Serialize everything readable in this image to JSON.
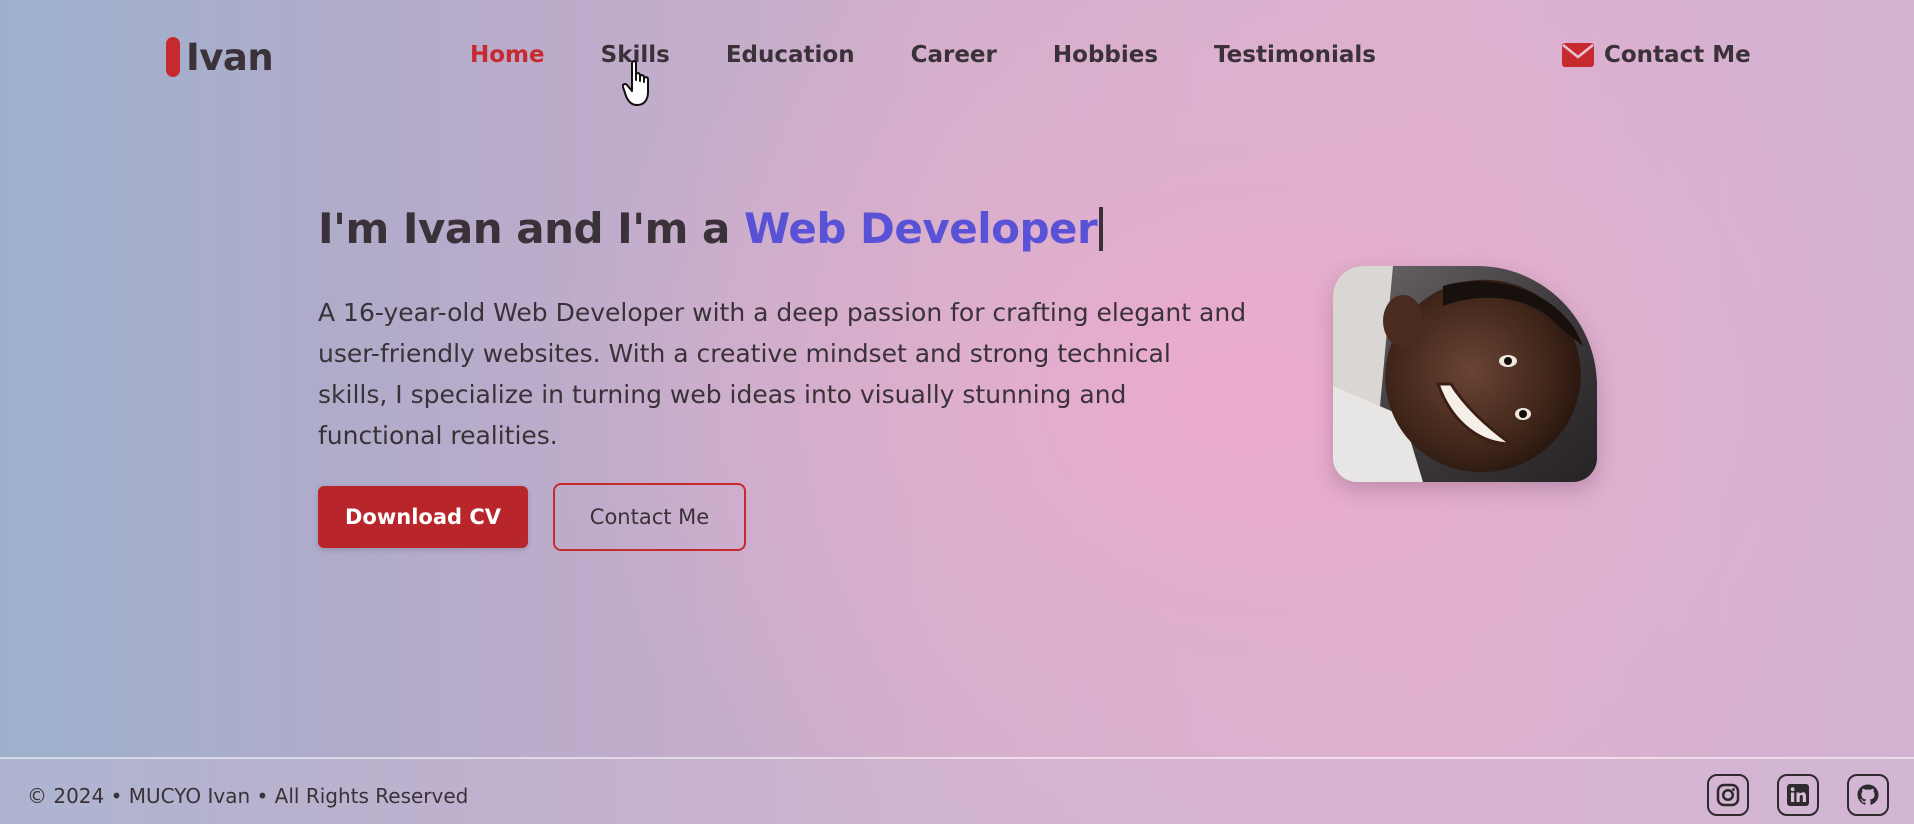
{
  "brand": {
    "name": "Ivan",
    "accent_color": "#c62a2f"
  },
  "nav": {
    "items": [
      {
        "label": "Home",
        "active": true
      },
      {
        "label": "Skills",
        "active": false
      },
      {
        "label": "Education",
        "active": false
      },
      {
        "label": "Career",
        "active": false
      },
      {
        "label": "Hobbies",
        "active": false
      },
      {
        "label": "Testimonials",
        "active": false
      }
    ],
    "contact": {
      "label": "Contact Me",
      "icon": "envelope-icon"
    }
  },
  "hero": {
    "title_prefix": "I'm Ivan and I'm a ",
    "title_accent": "Web Developer",
    "accent_color": "#5a52d6",
    "description": "A 16-year-old Web Developer with a deep passion for crafting elegant and user-friendly websites. With a creative mindset and strong technical skills, I specialize in turning web ideas into visually stunning and functional realities.",
    "primary_button": "Download CV",
    "secondary_button": "Contact Me"
  },
  "footer": {
    "copyright": "© 2024 • MUCYO Ivan • All Rights Reserved",
    "socials": [
      "instagram-icon",
      "linkedin-icon",
      "github-icon"
    ]
  }
}
